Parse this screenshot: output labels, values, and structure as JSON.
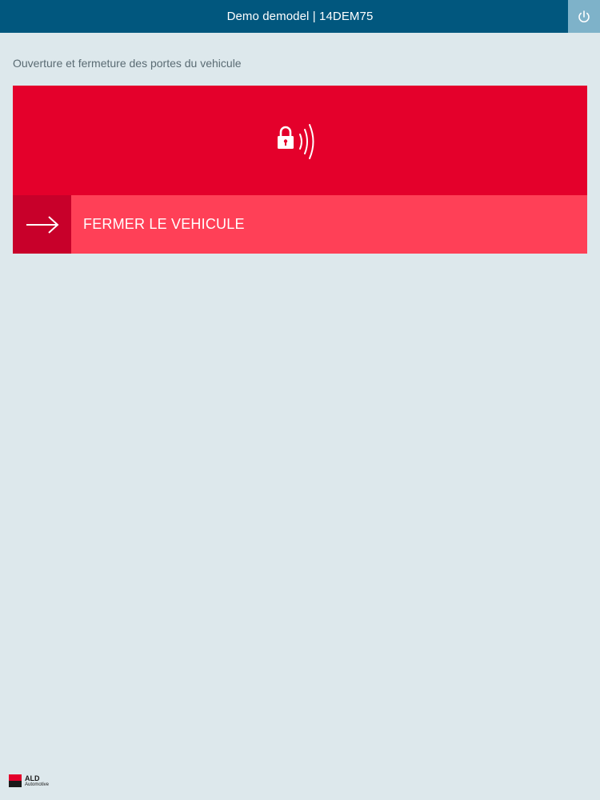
{
  "header": {
    "title": "Demo demodel | 14DEM75",
    "power_icon": "power-icon"
  },
  "page": {
    "subtitle": "Ouverture et fermeture des portes du vehicule"
  },
  "lock_card": {
    "status_icon": "lock-remote-icon",
    "action_icon": "arrow-right-icon",
    "action_label": "FERMER LE VEHICULE"
  },
  "footer": {
    "logo_name": "ALD",
    "logo_sub": "Automotive"
  },
  "colors": {
    "header_bg": "#01577e",
    "power_btn_bg": "#7eb2c9",
    "card_red": "#e4002b",
    "action_pink": "#ff4057",
    "arrow_box": "#c8002a",
    "page_bg": "#dde8ec"
  }
}
